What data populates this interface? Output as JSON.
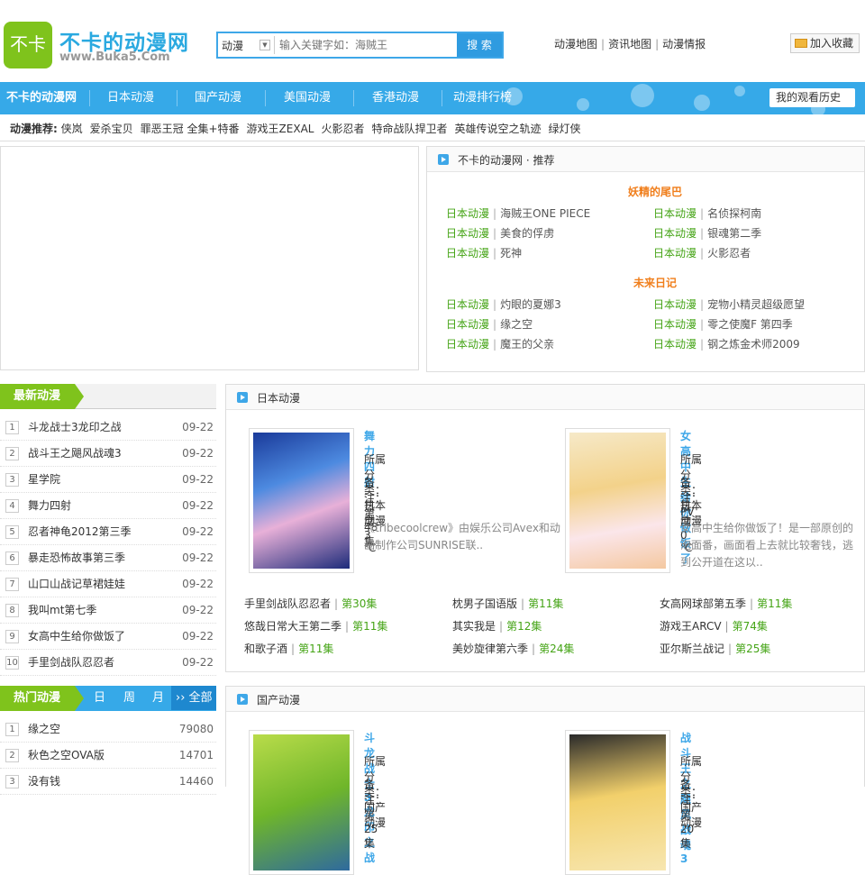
{
  "header": {
    "logo_mark": "不卡",
    "logo_text": "不卡的动漫网",
    "logo_url": "www.Buka5.Com",
    "search": {
      "category": "动漫",
      "placeholder": "输入关键字如：海贼王",
      "button": "搜 索"
    },
    "links": [
      "动漫地图",
      "资讯地图",
      "动漫情报"
    ],
    "favorite": "加入收藏"
  },
  "nav": {
    "home": "不卡的动漫网",
    "items": [
      "日本动漫",
      "国产动漫",
      "美国动漫",
      "香港动漫",
      "动漫排行榜"
    ],
    "history": "我的观看历史"
  },
  "recommend_bar": {
    "label": "动漫推荐:",
    "items": [
      "侠岚",
      "爱杀宝贝",
      "罪恶王冠 全集+特番",
      "游戏王ZEXAL",
      "火影忍者",
      "特命战队捍卫者",
      "英雄传说空之轨迹",
      "绿灯侠"
    ]
  },
  "panel": {
    "title": "不卡的动漫网 · 推荐",
    "groups": [
      {
        "title": "妖精的尾巴",
        "items": [
          {
            "cat": "日本动漫",
            "name": "海贼王ONE PIECE"
          },
          {
            "cat": "日本动漫",
            "name": "名侦探柯南"
          },
          {
            "cat": "日本动漫",
            "name": "美食的俘虏"
          },
          {
            "cat": "日本动漫",
            "name": "银魂第二季"
          },
          {
            "cat": "日本动漫",
            "name": "死神"
          },
          {
            "cat": "日本动漫",
            "name": "火影忍者"
          }
        ]
      },
      {
        "title": "未来日记",
        "items": [
          {
            "cat": "日本动漫",
            "name": "灼眼的夏娜3"
          },
          {
            "cat": "日本动漫",
            "name": "宠物小精灵超级愿望"
          },
          {
            "cat": "日本动漫",
            "name": "缘之空"
          },
          {
            "cat": "日本动漫",
            "name": "零之使魔F 第四季"
          },
          {
            "cat": "日本动漫",
            "name": "魔王的父亲"
          },
          {
            "cat": "日本动漫",
            "name": "钢之炼金术师2009"
          }
        ]
      }
    ]
  },
  "latest": {
    "title": "最新动漫",
    "items": [
      {
        "n": "1",
        "name": "斗龙战士3龙印之战",
        "date": "09-22"
      },
      {
        "n": "2",
        "name": "战斗王之飓风战魂3",
        "date": "09-22"
      },
      {
        "n": "3",
        "name": "星学院",
        "date": "09-22"
      },
      {
        "n": "4",
        "name": "舞力四射",
        "date": "09-22"
      },
      {
        "n": "5",
        "name": "忍者神龟2012第三季",
        "date": "09-22"
      },
      {
        "n": "6",
        "name": "暴走恐怖故事第三季",
        "date": "09-22"
      },
      {
        "n": "7",
        "name": "山口山战记草裙娃娃",
        "date": "09-22"
      },
      {
        "n": "8",
        "name": "我叫mt第七季",
        "date": "09-22"
      },
      {
        "n": "9",
        "name": "女高中生给你做饭了",
        "date": "09-22"
      },
      {
        "n": "10",
        "name": "手里剑战队忍忍者",
        "date": "09-22"
      }
    ]
  },
  "hot": {
    "title": "热门动漫",
    "tabs": [
      "日",
      "周",
      "月"
    ],
    "all": "›› 全部",
    "items": [
      {
        "n": "1",
        "name": "缘之空",
        "count": "79080"
      },
      {
        "n": "2",
        "name": "秋色之空OVA版",
        "count": "14701"
      },
      {
        "n": "3",
        "name": "没有钱",
        "count": "14460"
      }
    ]
  },
  "japan": {
    "title": "日本动漫",
    "cards": [
      {
        "title": "舞力四射",
        "cat": "所属分类：日本动漫",
        "note": "备注：第48集",
        "heat": "热度：3 ℃",
        "desc": "《tribecoolcrew》由娱乐公司Avex和动画制作公司SUNRISE联.."
      },
      {
        "title": "女高中生给你做饭了",
        "cat": "所属分类：日本动漫",
        "note": "备注：PV",
        "heat": "热度：0 ℃",
        "desc": "女高中生给你做饭了！是一部原创的泡面番，画面看上去就比较奢钱，逃到公开道在这以.."
      }
    ],
    "episodes": [
      {
        "name": "手里剑战队忍忍者",
        "ep": "第30集"
      },
      {
        "name": "枕男子国语版",
        "ep": "第11集"
      },
      {
        "name": "女高网球部第五季",
        "ep": "第11集"
      },
      {
        "name": "悠哉日常大王第二季",
        "ep": "第11集"
      },
      {
        "name": "其实我是",
        "ep": "第12集"
      },
      {
        "name": "游戏王ARCV",
        "ep": "第74集"
      },
      {
        "name": "和歌子酒",
        "ep": "第11集"
      },
      {
        "name": "美妙旋律第六季",
        "ep": "第24集"
      },
      {
        "name": "亚尔斯兰战记",
        "ep": "第25集"
      }
    ]
  },
  "china": {
    "title": "国产动漫",
    "cards": [
      {
        "title": "斗龙战士3龙印之战",
        "cat": "所属分类：国产动漫",
        "note": "备注：第25集"
      },
      {
        "title": "战斗王之飓风战魂3",
        "cat": "所属分类：国产动漫",
        "note": "备注：第20集"
      }
    ]
  },
  "colors": {
    "accent_blue": "#36a9e8",
    "accent_green": "#7fc31c",
    "orange": "#f07e1b",
    "link_green": "#45a416"
  }
}
